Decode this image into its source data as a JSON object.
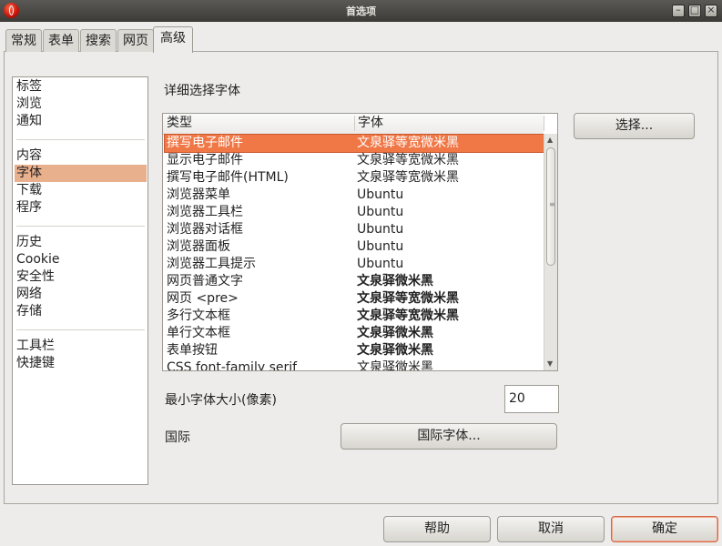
{
  "window": {
    "title": "首选项"
  },
  "tabs": [
    {
      "label": "常规"
    },
    {
      "label": "表单"
    },
    {
      "label": "搜索"
    },
    {
      "label": "网页"
    },
    {
      "label": "高级",
      "active": true
    }
  ],
  "sidebar": {
    "groups": [
      [
        "标签",
        "浏览",
        "通知"
      ],
      [
        "内容",
        "字体",
        "下载",
        "程序"
      ],
      [
        "历史",
        "Cookie",
        "安全性",
        "网络",
        "存储"
      ],
      [
        "工具栏",
        "快捷键"
      ]
    ],
    "selected": "字体"
  },
  "fonts": {
    "section_title": "详细选择字体",
    "columns": {
      "type": "类型",
      "font": "字体"
    },
    "rows": [
      {
        "type": "撰写电子邮件",
        "font": "文泉驿等宽微米黑",
        "selected": true
      },
      {
        "type": "显示电子邮件",
        "font": "文泉驿等宽微米黑"
      },
      {
        "type": "撰写电子邮件(HTML)",
        "font": "文泉驿等宽微米黑"
      },
      {
        "type": "浏览器菜单",
        "font": "Ubuntu"
      },
      {
        "type": "浏览器工具栏",
        "font": "Ubuntu"
      },
      {
        "type": "浏览器对话框",
        "font": "Ubuntu"
      },
      {
        "type": "浏览器面板",
        "font": "Ubuntu"
      },
      {
        "type": "浏览器工具提示",
        "font": "Ubuntu"
      },
      {
        "type": "网页普通文字",
        "font": "文泉驿微米黑",
        "bold": true
      },
      {
        "type": "网页 <pre>",
        "font": "文泉驿等宽微米黑",
        "bold": true
      },
      {
        "type": "多行文本框",
        "font": "文泉驿等宽微米黑",
        "bold": true
      },
      {
        "type": "单行文本框",
        "font": "文泉驿微米黑",
        "bold": true
      },
      {
        "type": "表单按钮",
        "font": "文泉驿微米黑",
        "bold": true
      },
      {
        "type": "CSS font-family serif",
        "font": "文泉驿微米黑"
      }
    ],
    "choose_button": "选择...",
    "min_size_label": "最小字体大小(像素)",
    "min_size_value": "20",
    "international_label": "国际",
    "international_button": "国际字体..."
  },
  "footer": {
    "help": "帮助",
    "cancel": "取消",
    "ok": "确定"
  },
  "colors": {
    "selection": "#f07746",
    "sidebar_selection": "#e9b08e",
    "titlebar": "#3c3b37"
  }
}
